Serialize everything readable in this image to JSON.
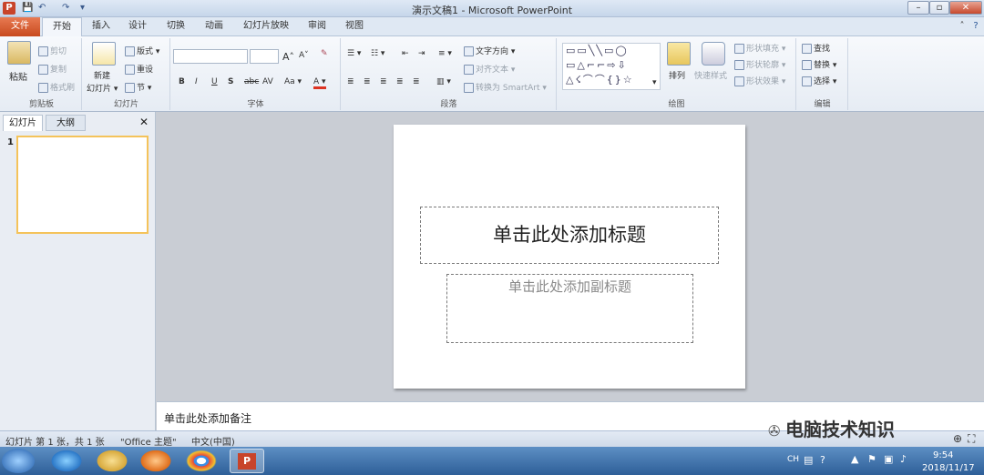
{
  "window": {
    "title": "演示文稿1 - Microsoft PowerPoint",
    "app_icon": "P",
    "minimize": "–",
    "restore": "▫",
    "close": "✕"
  },
  "qat": {
    "save": "💾",
    "undo": "↶",
    "redo": "↷",
    "more": "▾"
  },
  "tabs": [
    "文件",
    "开始",
    "插入",
    "设计",
    "切换",
    "动画",
    "幻灯片放映",
    "审阅",
    "视图"
  ],
  "ribbon": {
    "clipboard": {
      "label": "剪贴板",
      "paste": "粘贴",
      "cut": "剪切",
      "copy": "复制",
      "format_painter": "格式刷"
    },
    "slides": {
      "label": "幻灯片",
      "new_slide_line1": "新建",
      "new_slide_line2": "幻灯片 ▾",
      "layout": "版式 ▾",
      "reset": "重设",
      "section": "节 ▾"
    },
    "font": {
      "label": "字体",
      "bold": "B",
      "italic": "I",
      "underline": "U",
      "strike": "S",
      "abc": "abc",
      "spacing": "AV",
      "case": "Aa ▾",
      "color": "A ▾",
      "grow": "A˄",
      "shrink": "A˅"
    },
    "paragraph": {
      "label": "段落",
      "text_direction": "文字方向 ▾",
      "align_text": "对齐文本 ▾",
      "smartart": "转换为 SmartArt ▾"
    },
    "drawing": {
      "label": "绘图",
      "arrange": "排列",
      "quick_styles": "快速样式",
      "shape_fill": "形状填充 ▾",
      "shape_outline": "形状轮廓 ▾",
      "shape_effects": "形状效果 ▾"
    },
    "editing": {
      "label": "编辑",
      "find": "查找",
      "replace": "替换 ▾",
      "select": "选择 ▾"
    }
  },
  "left_pane": {
    "tab_slides": "幻灯片",
    "tab_outline": "大纲",
    "close": "✕",
    "slide_number": "1"
  },
  "slide": {
    "title_placeholder": "单击此处添加标题",
    "subtitle_placeholder": "单击此处添加副标题"
  },
  "notes": {
    "placeholder": "单击此处添加备注"
  },
  "status": {
    "slide_info": "幻灯片 第 1 张，共 1 张",
    "theme": "\"Office 主题\"",
    "language": "中文(中国)"
  },
  "taskbar": {
    "lang": "CH",
    "time": "9:54",
    "date": "2018/11/17"
  },
  "watermark": {
    "text": "电脑技术知识"
  },
  "colors": {
    "file_tab": "#d4562a",
    "accent": "#2b5797",
    "taskbar": "#3a6ea5"
  }
}
